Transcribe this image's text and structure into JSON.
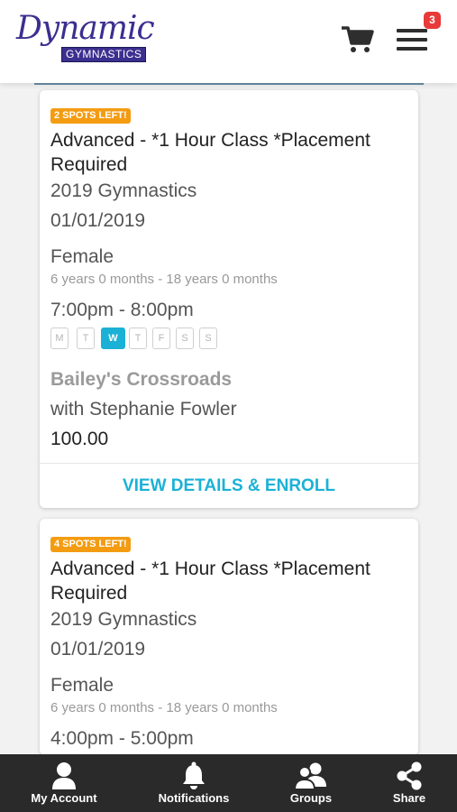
{
  "header": {
    "logo_script": "Dynamic",
    "logo_sub": "GYMNASTICS",
    "cart_icon": "cart-icon",
    "menu_icon": "hamburger-menu-icon",
    "menu_badge": "3"
  },
  "classes": [
    {
      "spots": "2 SPOTS LEFT!",
      "title": "Advanced - *1 Hour Class *Placement Required",
      "program": "2019 Gymnastics",
      "date": "01/01/2019",
      "gender": "Female",
      "age_range": "6 years 0 months - 18 years 0 months",
      "time": "7:00pm - 8:00pm",
      "days": [
        "M",
        "T",
        "W",
        "T",
        "F",
        "S",
        "S"
      ],
      "active_day": "W",
      "location": "Bailey's Crossroads",
      "instructor": "with Stephanie Fowler",
      "price": "100.00",
      "enroll_label": "VIEW DETAILS & ENROLL"
    },
    {
      "spots": "4 SPOTS LEFT!",
      "title": "Advanced - *1 Hour Class *Placement Required",
      "program": "2019 Gymnastics",
      "date": "01/01/2019",
      "gender": "Female",
      "age_range": "6 years 0 months - 18 years 0 months",
      "time": "4:00pm - 5:00pm"
    }
  ],
  "bottom_nav": [
    {
      "label": "My Account",
      "icon": "user-icon"
    },
    {
      "label": "Notifications",
      "icon": "bell-icon"
    },
    {
      "label": "Groups",
      "icon": "group-icon"
    },
    {
      "label": "Share",
      "icon": "share-icon"
    }
  ],
  "colors": {
    "accent": "#1bb1d6",
    "spots_badge": "#f39c12",
    "brand": "#3b2f8f",
    "nav_bg": "#2a2a2a",
    "menu_badge": "#e83a3a"
  }
}
